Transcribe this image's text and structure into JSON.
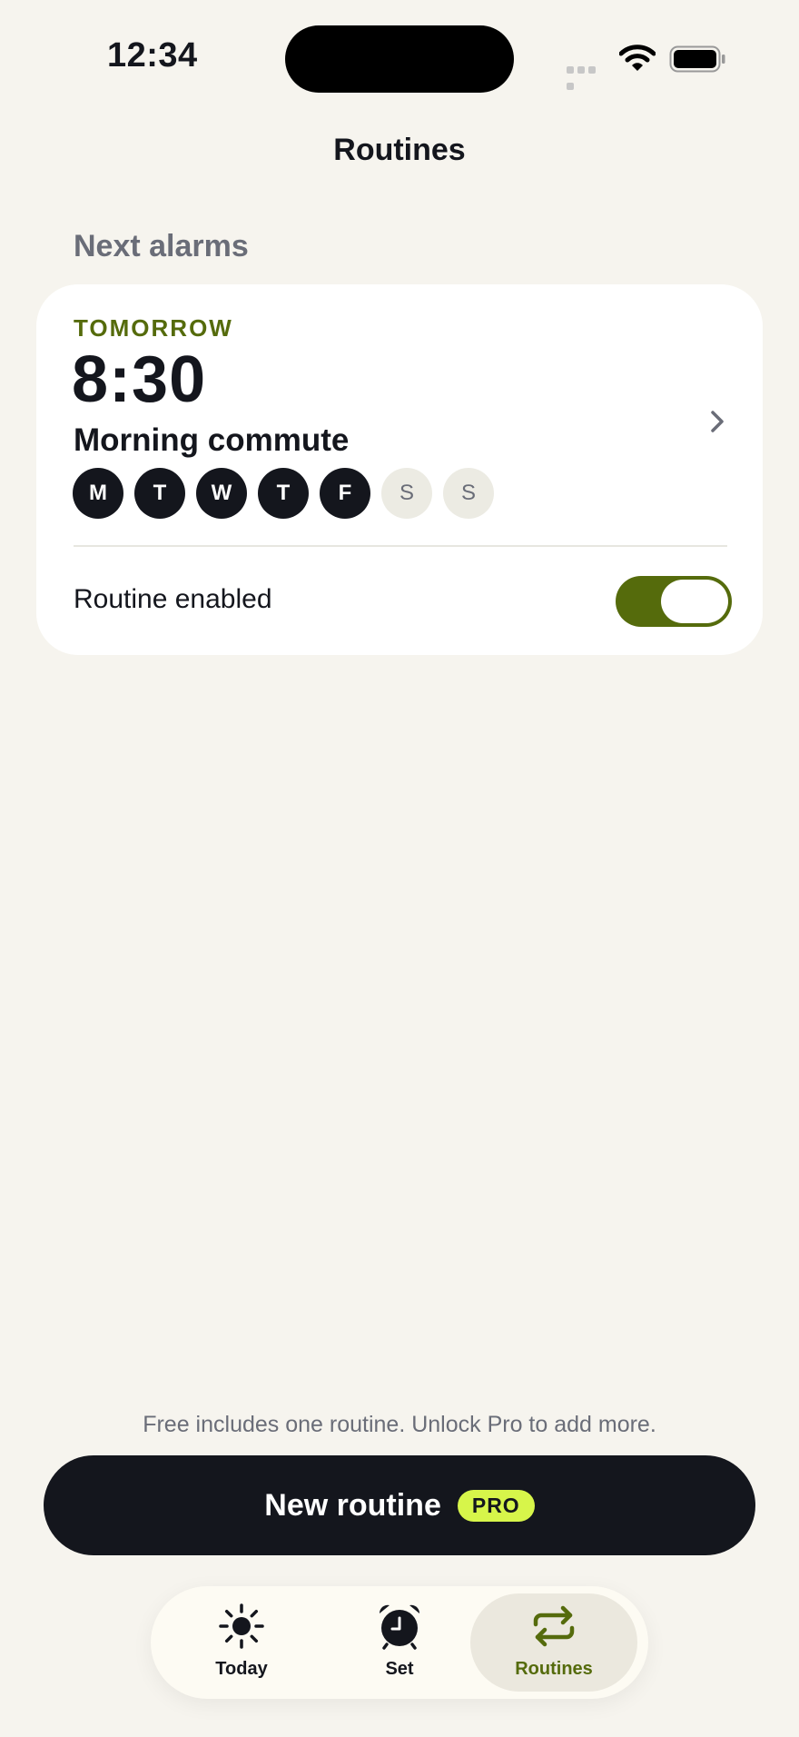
{
  "status_bar": {
    "time": "12:34"
  },
  "header": {
    "title": "Routines"
  },
  "section": {
    "label": "Next alarms"
  },
  "routine": {
    "when": "TOMORROW",
    "time": "8:30",
    "name": "Morning commute",
    "days": [
      {
        "letter": "M",
        "active": true
      },
      {
        "letter": "T",
        "active": true
      },
      {
        "letter": "W",
        "active": true
      },
      {
        "letter": "T",
        "active": true
      },
      {
        "letter": "F",
        "active": true
      },
      {
        "letter": "S",
        "active": false
      },
      {
        "letter": "S",
        "active": false
      }
    ],
    "toggle_label": "Routine enabled",
    "enabled": true
  },
  "footer": {
    "note": "Free includes one routine. Unlock Pro to add more.",
    "button_label": "New routine",
    "badge": "PRO"
  },
  "tabs": [
    {
      "label": "Today",
      "icon": "sun-icon",
      "active": false
    },
    {
      "label": "Set",
      "icon": "alarm-clock-icon",
      "active": false
    },
    {
      "label": "Routines",
      "icon": "repeat-icon",
      "active": true
    }
  ],
  "colors": {
    "accent": "#556b0c",
    "dark": "#14161d",
    "badge": "#d7f54a",
    "background": "#f6f4ee"
  }
}
